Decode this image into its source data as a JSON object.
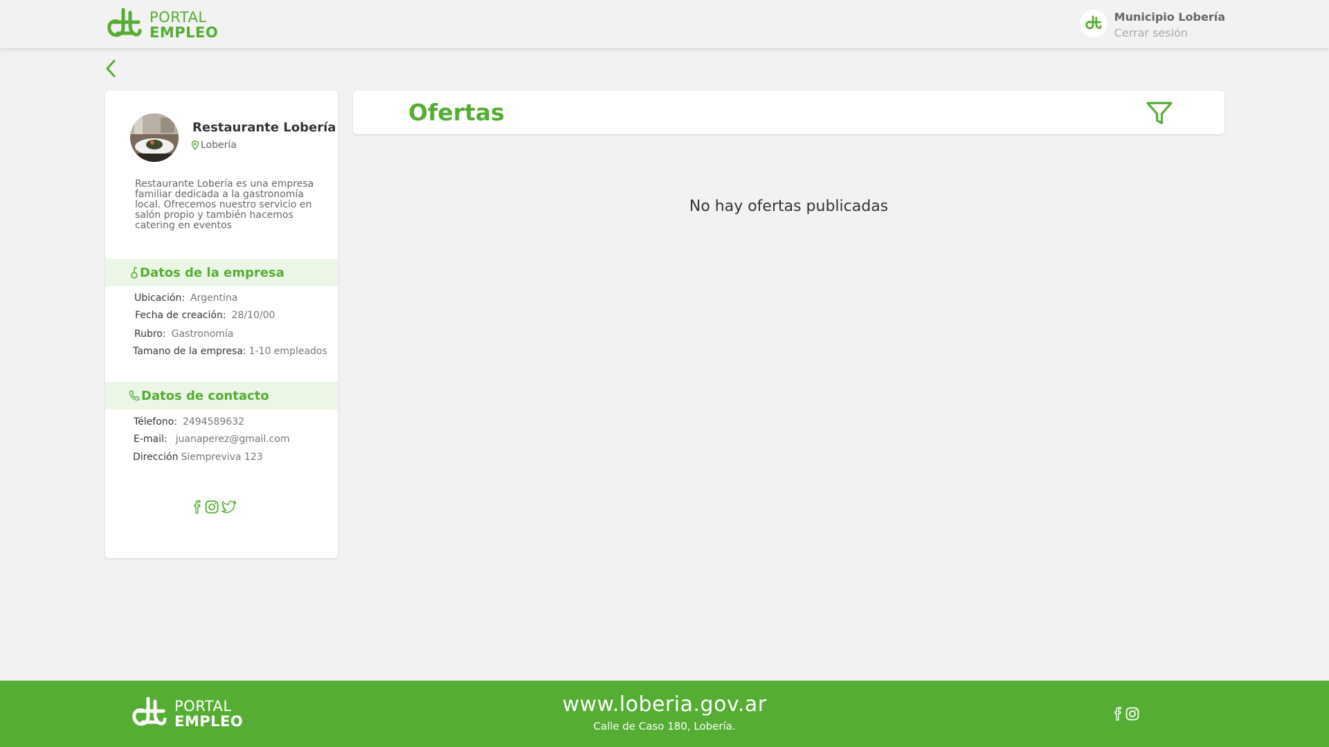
{
  "header": {
    "logo": {
      "line1": "PORTAL",
      "line2": "EMPLEO"
    },
    "user": {
      "name": "Municipio Lobería",
      "logout": "Cerrar sesión"
    }
  },
  "company": {
    "name": "Restaurante Lobería",
    "location": "Lobería",
    "description": "Restaurante Lobería es una empresa familiar dedicada a la gastronomía local. Ofrecemos nuestro servicio en salón propio  y también hacemos catering en eventos",
    "data_section": {
      "title": "Datos de la empresa",
      "rows": [
        {
          "label": "Ubicación:",
          "value": "Argentina"
        },
        {
          "label": "Fecha de creación:",
          "value": "28/10/00"
        },
        {
          "label": "Rubro:",
          "value": "Gastronomía"
        },
        {
          "label": "Tamano de la empresa:",
          "value": "1-10 empleados"
        }
      ]
    },
    "contact_section": {
      "title": "Datos de contacto",
      "rows": [
        {
          "label": "Télefono:",
          "value": "2494589632"
        },
        {
          "label": "E-mail:",
          "value": "juanaperez@gmail.com"
        },
        {
          "label": "Dirección",
          "value": "Siempreviva 123"
        }
      ]
    },
    "social_icons": [
      "facebook-icon",
      "instagram-icon",
      "twitter-icon"
    ]
  },
  "offers": {
    "title": "Ofertas",
    "empty_message": "No hay ofertas publicadas"
  },
  "footer": {
    "logo": {
      "line1": "PORTAL",
      "line2": "EMPLEO"
    },
    "url": "www.loberia.gov.ar",
    "address": "Calle de Caso 180, Lobería.",
    "social_icons": [
      "facebook-icon",
      "instagram-icon"
    ]
  },
  "colors": {
    "brand_green": "#55ad33",
    "section_bg": "#ebf6e7",
    "page_bg": "#f2f2f2"
  }
}
